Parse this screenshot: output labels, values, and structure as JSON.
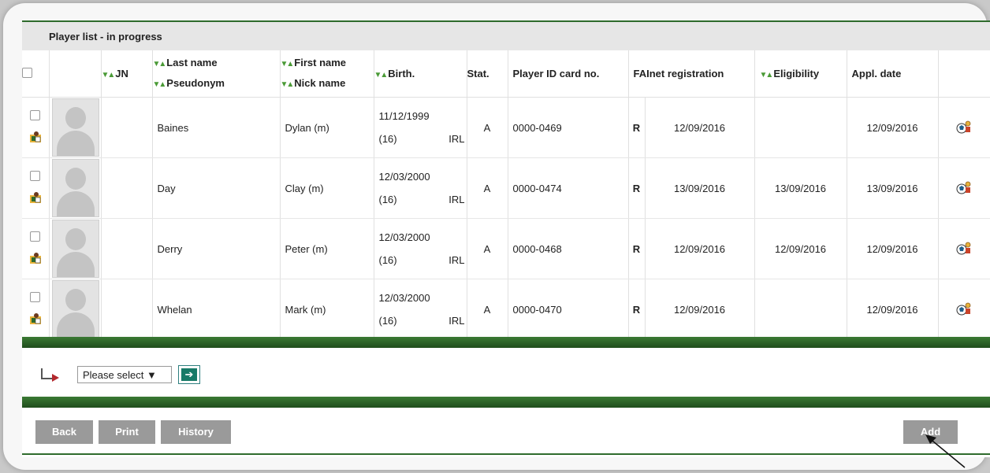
{
  "panel_title": "Player list - in progress",
  "columns": {
    "jn": "JN",
    "last_name": "Last name",
    "pseudonym": "Pseudonym",
    "first_name": "First name",
    "nick_name": "Nick name",
    "birth": "Birth.",
    "stat": "Stat.",
    "player_id": "Player ID card no.",
    "fainet": "FAInet registration",
    "eligibility": "Eligibility",
    "appl_date": "Appl. date"
  },
  "players": [
    {
      "last_name": "Baines",
      "first_name": "Dylan (m)",
      "birth_date": "11/12/1999",
      "age": "(16)",
      "nation": "IRL",
      "stat": "A",
      "id_card": "0000-0469",
      "reg_flag": "R",
      "fainet_date": "12/09/2016",
      "eligibility": "",
      "appl_date": "12/09/2016"
    },
    {
      "last_name": "Day",
      "first_name": "Clay (m)",
      "birth_date": "12/03/2000",
      "age": "(16)",
      "nation": "IRL",
      "stat": "A",
      "id_card": "0000-0474",
      "reg_flag": "R",
      "fainet_date": "13/09/2016",
      "eligibility": "13/09/2016",
      "appl_date": "13/09/2016"
    },
    {
      "last_name": "Derry",
      "first_name": "Peter (m)",
      "birth_date": "12/03/2000",
      "age": "(16)",
      "nation": "IRL",
      "stat": "A",
      "id_card": "0000-0468",
      "reg_flag": "R",
      "fainet_date": "12/09/2016",
      "eligibility": "12/09/2016",
      "appl_date": "12/09/2016"
    },
    {
      "last_name": "Whelan",
      "first_name": "Mark (m)",
      "birth_date": "12/03/2000",
      "age": "(16)",
      "nation": "IRL",
      "stat": "A",
      "id_card": "0000-0470",
      "reg_flag": "R",
      "fainet_date": "12/09/2016",
      "eligibility": "",
      "appl_date": "12/09/2016"
    }
  ],
  "bulk": {
    "select_label": "Please select",
    "go_glyph": "➔"
  },
  "buttons": {
    "back": "Back",
    "print": "Print",
    "history": "History",
    "add": "Add"
  },
  "icons": {
    "sort": "sort-arrows-icon",
    "role": "player-role-icon",
    "edit": "player-detail-icon",
    "checkbox": "checkbox-icon",
    "dropdown": "dropdown-arrow-icon"
  },
  "colors": {
    "accent_green": "#2f6b2d",
    "button_gray": "#9a9a9a",
    "go_button": "#177a67"
  }
}
